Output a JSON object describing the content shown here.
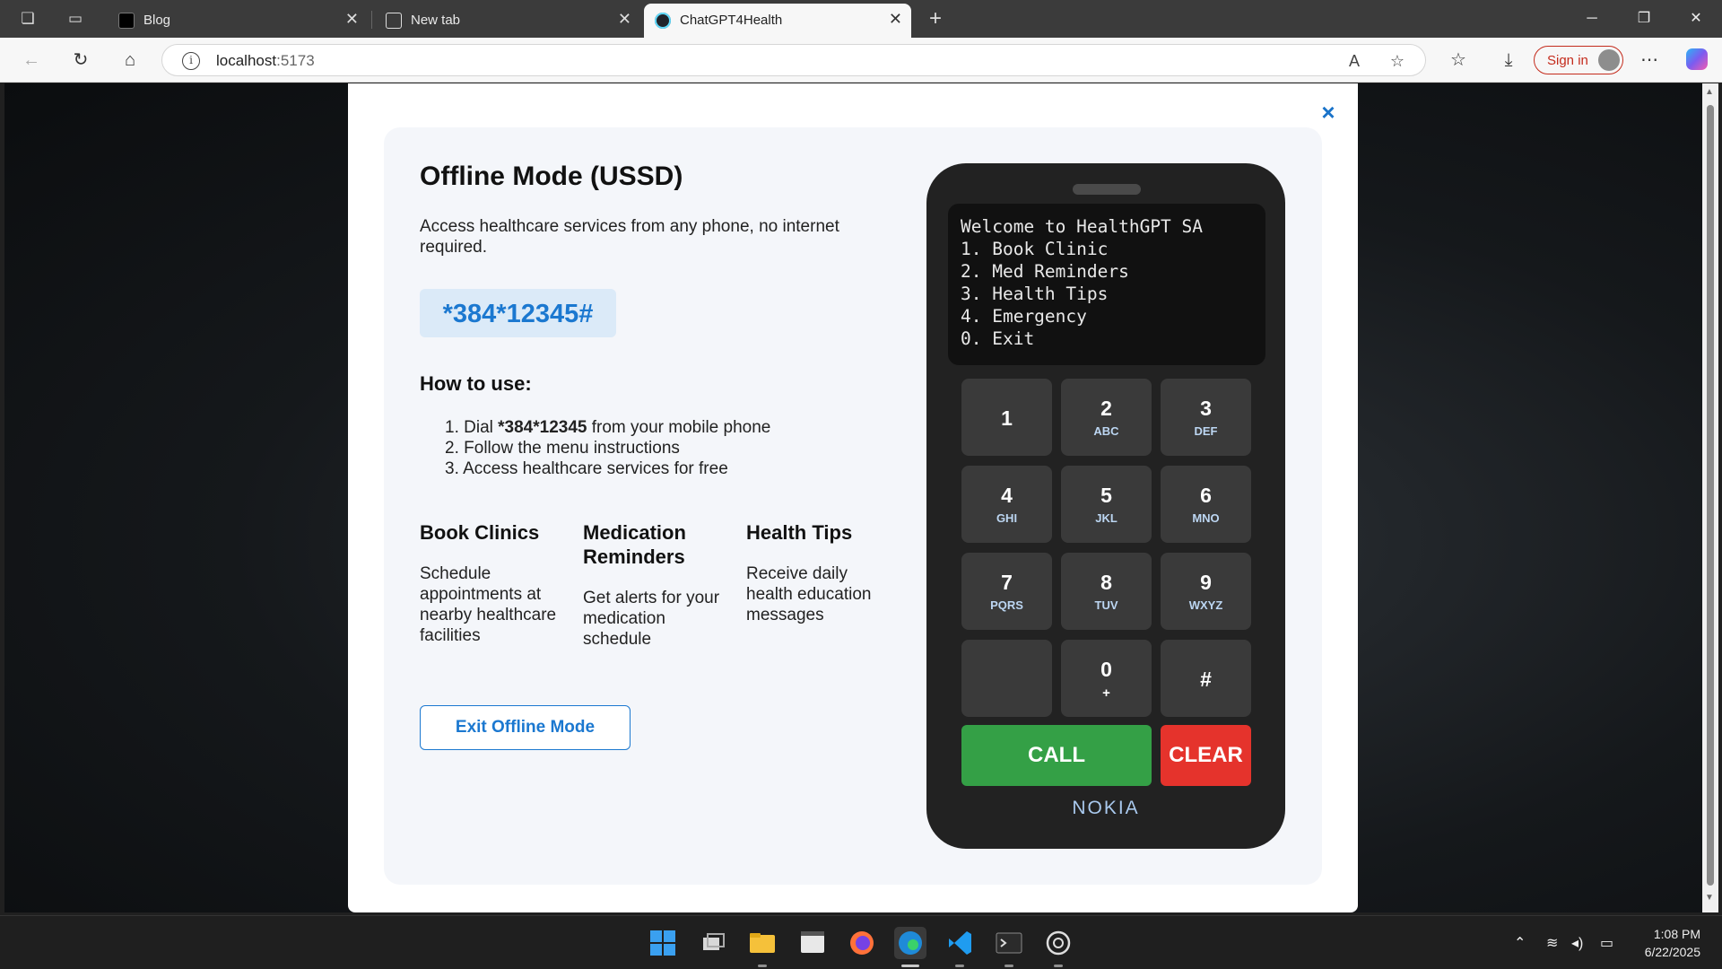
{
  "browser": {
    "tabs": [
      {
        "title": "Blog"
      },
      {
        "title": "New tab"
      },
      {
        "title": "ChatGPT4Health"
      }
    ],
    "url_host": "localhost",
    "url_port": ":5173",
    "sign_in_label": "Sign in",
    "icons": [
      "workspaces-icon",
      "tab-actions-icon",
      "new-tab-plus-icon",
      "minimize-icon",
      "restore-icon",
      "close-window-icon",
      "back-icon",
      "refresh-icon",
      "home-icon",
      "info-icon",
      "read-aloud-icon",
      "favorite-star-icon",
      "favorites-icon",
      "downloads-icon",
      "more-icon",
      "copilot-icon"
    ]
  },
  "offline": {
    "title": "Offline Mode (USSD)",
    "description": "Access healthcare services from any phone, no internet required.",
    "ussd_code": "*384*12345#",
    "how_to_title": "How to use:",
    "steps": [
      {
        "num": "1.",
        "pre": "Dial ",
        "bold": "*384*12345",
        "post": " from your mobile phone"
      },
      {
        "num": "2.",
        "text": "Follow the menu instructions"
      },
      {
        "num": "3.",
        "text": "Access healthcare services for free"
      }
    ],
    "features": [
      {
        "title": "Book Clinics",
        "text": "Schedule appointments at nearby healthcare facilities"
      },
      {
        "title": "Medication Reminders",
        "text": "Get alerts for your medication schedule"
      },
      {
        "title": "Health Tips",
        "text": "Receive daily health education messages"
      }
    ],
    "exit_label": "Exit Offline Mode",
    "close_symbol": "×"
  },
  "phone": {
    "screen_lines": [
      "Welcome to HealthGPT SA",
      "1. Book Clinic",
      "2. Med Reminders",
      "3. Health Tips",
      "4. Emergency",
      "0. Exit"
    ],
    "keys": [
      {
        "num": "1",
        "letters": ""
      },
      {
        "num": "2",
        "letters": "ABC"
      },
      {
        "num": "3",
        "letters": "DEF"
      },
      {
        "num": "4",
        "letters": "GHI"
      },
      {
        "num": "5",
        "letters": "JKL"
      },
      {
        "num": "6",
        "letters": "MNO"
      },
      {
        "num": "7",
        "letters": "PQRS"
      },
      {
        "num": "8",
        "letters": "TUV"
      },
      {
        "num": "9",
        "letters": "WXYZ"
      },
      {
        "num": "",
        "letters": ""
      },
      {
        "num": "0",
        "letters": "+"
      },
      {
        "num": "#",
        "letters": ""
      }
    ],
    "call_label": "CALL",
    "clear_label": "CLEAR",
    "brand": "NOKIA"
  },
  "taskbar": {
    "apps": [
      "start-icon",
      "task-view-icon",
      "file-explorer-icon",
      "clipchamp-icon",
      "firefox-icon",
      "edge-icon",
      "vscode-icon",
      "terminal-icon",
      "chatgpt-icon"
    ],
    "active_app": "edge-icon",
    "time": "1:08 PM",
    "date": "6/22/2025"
  },
  "colors": {
    "accent": "#1b78d0",
    "call": "#34a046",
    "clear": "#e5332c",
    "code_bg": "#dbeaf8"
  }
}
